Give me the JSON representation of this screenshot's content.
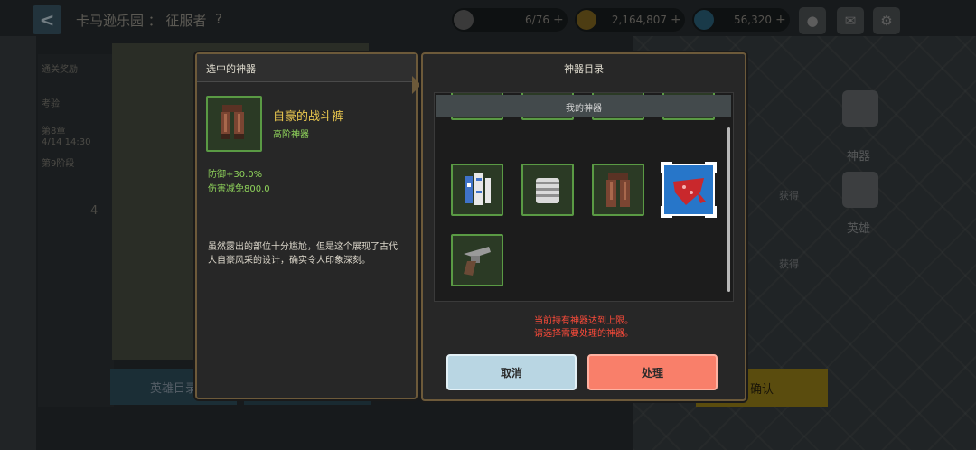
{
  "topbar": {
    "title": "卡马逊乐园 ： 征服者",
    "help": "?",
    "resource_stamina": "6/76",
    "resource_gold": "2,164,807",
    "resource_gems": "56,320",
    "plus": "+"
  },
  "background": {
    "side_rows": [
      "通关奖励",
      "考验",
      "第8章",
      "4/14 14:30",
      "第9阶段",
      "4"
    ],
    "hero_catalog_button": "英雄目录",
    "confirm_button": "确认",
    "get_label_1": "获得",
    "get_label_2": "获得",
    "artifact_label": "神器",
    "hero_label": "英雄"
  },
  "selected_panel": {
    "header": "选中的神器",
    "name": "自豪的战斗裤",
    "grade": "高阶神器",
    "stat_1": "防御+30.0%",
    "stat_2": "伤害减免800.0",
    "description": "虽然露出的部位十分尴尬，但是这个展现了古代人自豪风采的设计，确实令人印象深刻。"
  },
  "catalog_panel": {
    "header": "神器目录",
    "subheader": "我的神器",
    "items": [
      {
        "icon": "revolver-icon",
        "selected": false
      },
      {
        "icon": "pants-icon",
        "selected": false
      },
      {
        "icon": "goggles-icon",
        "selected": false
      },
      {
        "icon": "red-chest-icon",
        "selected": false
      },
      {
        "icon": "scroll-bottles-icon",
        "selected": false
      },
      {
        "icon": "armor-icon",
        "selected": false
      },
      {
        "icon": "pants-icon",
        "selected": false
      },
      {
        "icon": "bandana-icon",
        "selected": true
      },
      {
        "icon": "revolver-icon",
        "selected": false
      }
    ],
    "warning_line_1": "当前持有神器达到上限。",
    "warning_line_2": "请选择需要处理的神器。",
    "cancel_button": "取消",
    "process_button": "处理"
  },
  "colors": {
    "panel_border": "#6d5a3a",
    "slot_green": "#5a9a44",
    "selected_blue": "#2776c9",
    "warning_red": "#ff4b3a",
    "name_gold": "#e8c64e",
    "stat_green": "#8fd35b"
  }
}
